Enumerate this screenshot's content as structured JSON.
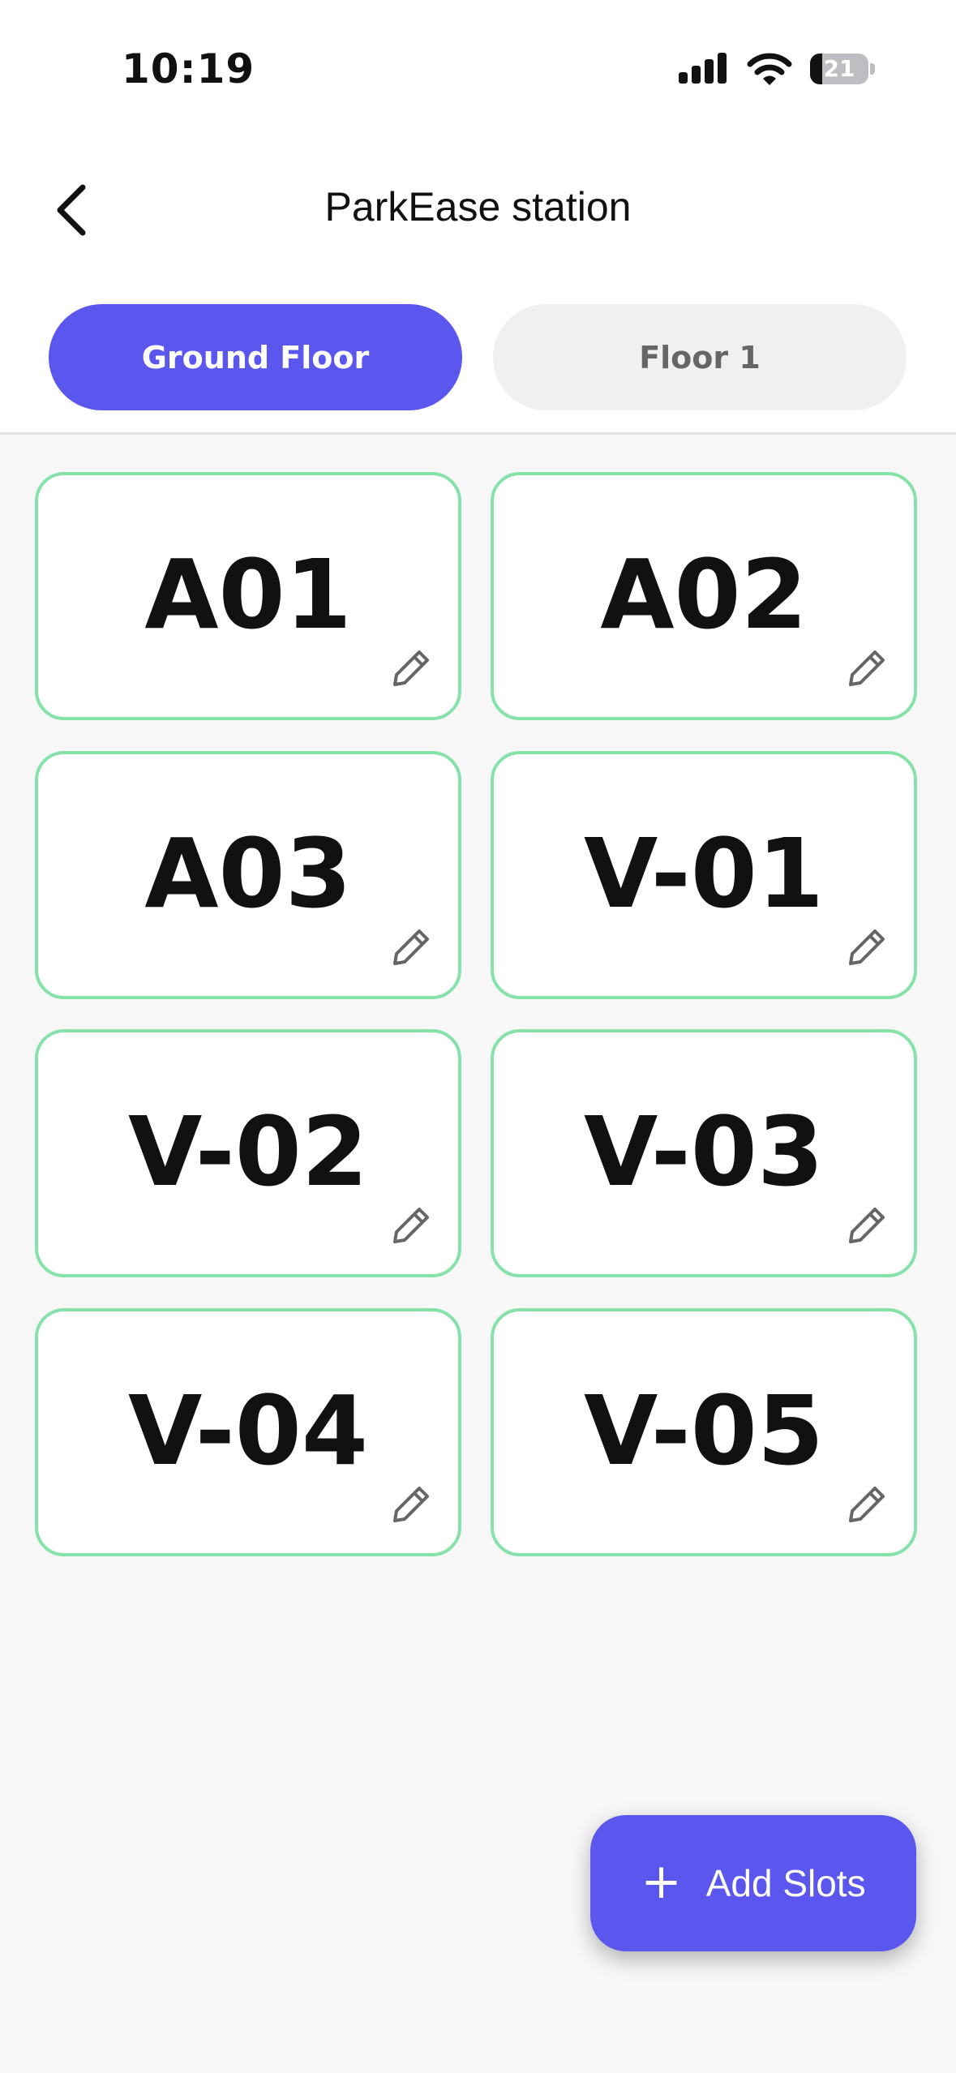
{
  "status_bar": {
    "time": "10:19",
    "battery": "21",
    "battery_level": 0.21,
    "icons": [
      "signal-icon",
      "wifi-icon",
      "battery-icon"
    ]
  },
  "header": {
    "back_icon": "chevron-left-icon",
    "title": "ParkEase station"
  },
  "tabs": [
    {
      "label": "Ground Floor",
      "active": true
    },
    {
      "label": "Floor 1",
      "active": false
    }
  ],
  "slots": [
    {
      "label": "A01",
      "icon": "pencil-icon"
    },
    {
      "label": "A02",
      "icon": "pencil-icon"
    },
    {
      "label": "A03",
      "icon": "pencil-icon"
    },
    {
      "label": "V-01",
      "icon": "pencil-icon"
    },
    {
      "label": "V-02",
      "icon": "pencil-icon"
    },
    {
      "label": "V-03",
      "icon": "pencil-icon"
    },
    {
      "label": "V-04",
      "icon": "pencil-icon"
    },
    {
      "label": "V-05",
      "icon": "pencil-icon"
    }
  ],
  "fab": {
    "icon": "plus",
    "label": "Add Slots"
  },
  "colors": {
    "accent": "#5b57ee",
    "slot_border": "#86e2a9",
    "tab_inactive_bg": "#f0f0f1",
    "background": "#f7f7f8"
  }
}
